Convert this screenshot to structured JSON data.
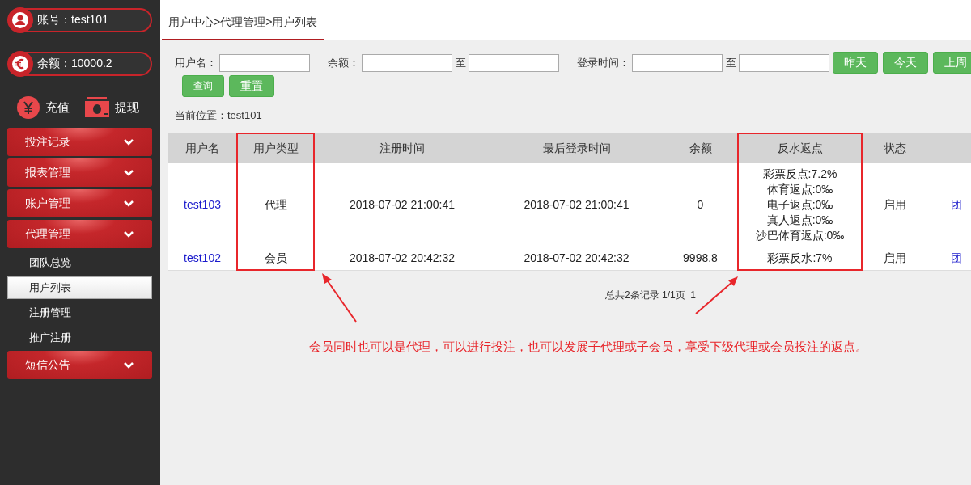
{
  "account": {
    "label": "账号：test101"
  },
  "balance": {
    "label": "余额：10000.2"
  },
  "actions": [
    {
      "kind": "recharge",
      "label": "充值"
    },
    {
      "kind": "withdraw",
      "label": "提现"
    }
  ],
  "menu": [
    {
      "label": "投注记录"
    },
    {
      "label": "报表管理"
    },
    {
      "label": "账户管理"
    },
    {
      "label": "代理管理",
      "children": [
        {
          "label": "团队总览",
          "selected": false
        },
        {
          "label": "用户列表",
          "selected": true
        },
        {
          "label": "注册管理",
          "selected": false
        },
        {
          "label": "推广注册",
          "selected": false
        }
      ]
    },
    {
      "label": "短信公告"
    }
  ],
  "breadcrumb": "用户中心>代理管理>用户列表",
  "filters": {
    "username_label": "用户名：",
    "balance_label": "余额：",
    "to_label": "至",
    "login_label": "登录时间：",
    "to_label_2": "至"
  },
  "quick_buttons": [
    "昨天",
    "今天",
    "上周"
  ],
  "action_buttons": [
    "查询",
    "重置"
  ],
  "location": "当前位置：test101",
  "table": {
    "columns": [
      {
        "label": "用户名",
        "highlighted": false
      },
      {
        "label": "用户类型",
        "highlighted": true
      },
      {
        "label": "注册时间",
        "highlighted": false
      },
      {
        "label": "最后登录时间",
        "highlighted": false
      },
      {
        "label": "余额",
        "highlighted": false
      },
      {
        "label": "反水返点",
        "highlighted": true
      },
      {
        "label": "状态",
        "highlighted": false
      },
      {
        "highlighted": false
      }
    ],
    "rows": [
      {
        "username": "test103",
        "type": "代理",
        "registered": "2018-07-02 21:00:41",
        "last_login": "2018-07-02 21:00:41",
        "balance": "0",
        "rebates": [
          "彩票反点:7.2%",
          "体育返点:0‰",
          "电子返点:0‰",
          "真人返点:0‰",
          "沙巴体育返点:0‰"
        ],
        "status": "启用",
        "action": "团"
      },
      {
        "username": "test102",
        "type": "会员",
        "registered": "2018-07-02 20:42:32",
        "last_login": "2018-07-02 20:42:32",
        "balance": "9998.8",
        "rebates": [
          "彩票反水:7%"
        ],
        "status": "启用",
        "action": "团"
      }
    ]
  },
  "pagination": "总共2条记录 1/1页  1",
  "annotation": "会员同时也可以是代理，可以进行投注，也可以发展子代理或子会员，享受下级代理或会员投注的返点。"
}
